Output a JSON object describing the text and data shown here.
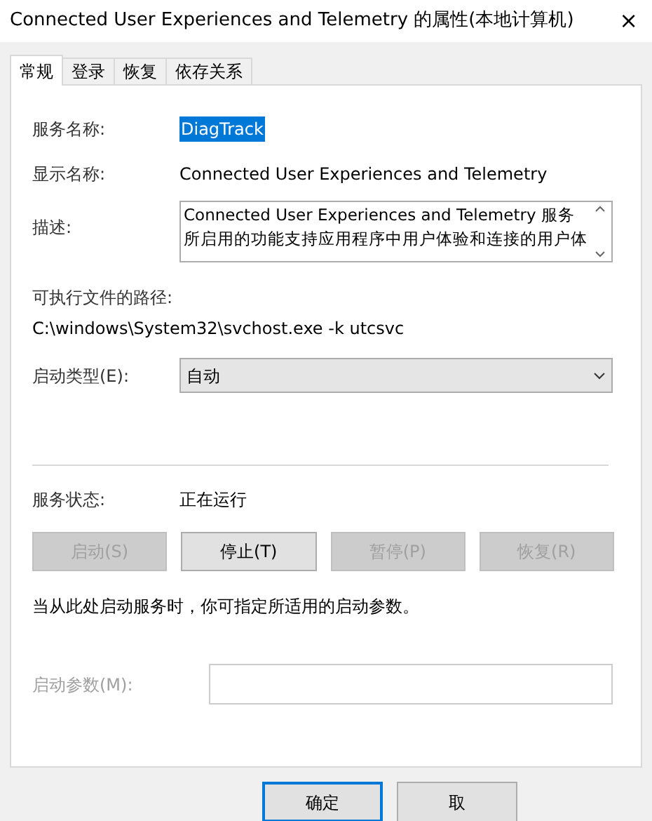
{
  "window": {
    "title": "Connected User Experiences and Telemetry 的属性(本地计算机)",
    "close": "×"
  },
  "tabs": [
    {
      "label": "常规",
      "selected": true
    },
    {
      "label": "登录",
      "selected": false
    },
    {
      "label": "恢复",
      "selected": false
    },
    {
      "label": "依存关系",
      "selected": false
    }
  ],
  "service_name": {
    "label": "服务名称:",
    "value": "DiagTrack",
    "highlighted": true
  },
  "display_name": {
    "label": "显示名称:",
    "value": "Connected User Experiences and Telemetry"
  },
  "description": {
    "label": "描述:",
    "lines": [
      "Connected User Experiences and Telemetry 服务",
      "所启用的功能支持应用程序中用户体验和连接的用户体"
    ]
  },
  "executable_path": {
    "label": "可执行文件的路径:",
    "value": "C:\\windows\\System32\\svchost.exe -k utcsvc"
  },
  "startup_type": {
    "label": "启动类型(E):",
    "value": "自动"
  },
  "service_status": {
    "label": "服务状态:",
    "value": "正在运行"
  },
  "service_buttons": [
    {
      "label": "启动(S)",
      "disabled": true
    },
    {
      "label": "停止(T)",
      "disabled": false
    },
    {
      "label": "暂停(P)",
      "disabled": true
    },
    {
      "label": "恢复(R)",
      "disabled": true
    }
  ],
  "hint": "当从此处启动服务时，你可指定所适用的启动参数。",
  "start_parameters": {
    "label": "启动参数(M):",
    "disabled": true
  },
  "dialog_buttons": [
    {
      "label": "确定",
      "default": true
    },
    {
      "label": "取",
      "default": false
    }
  ]
}
